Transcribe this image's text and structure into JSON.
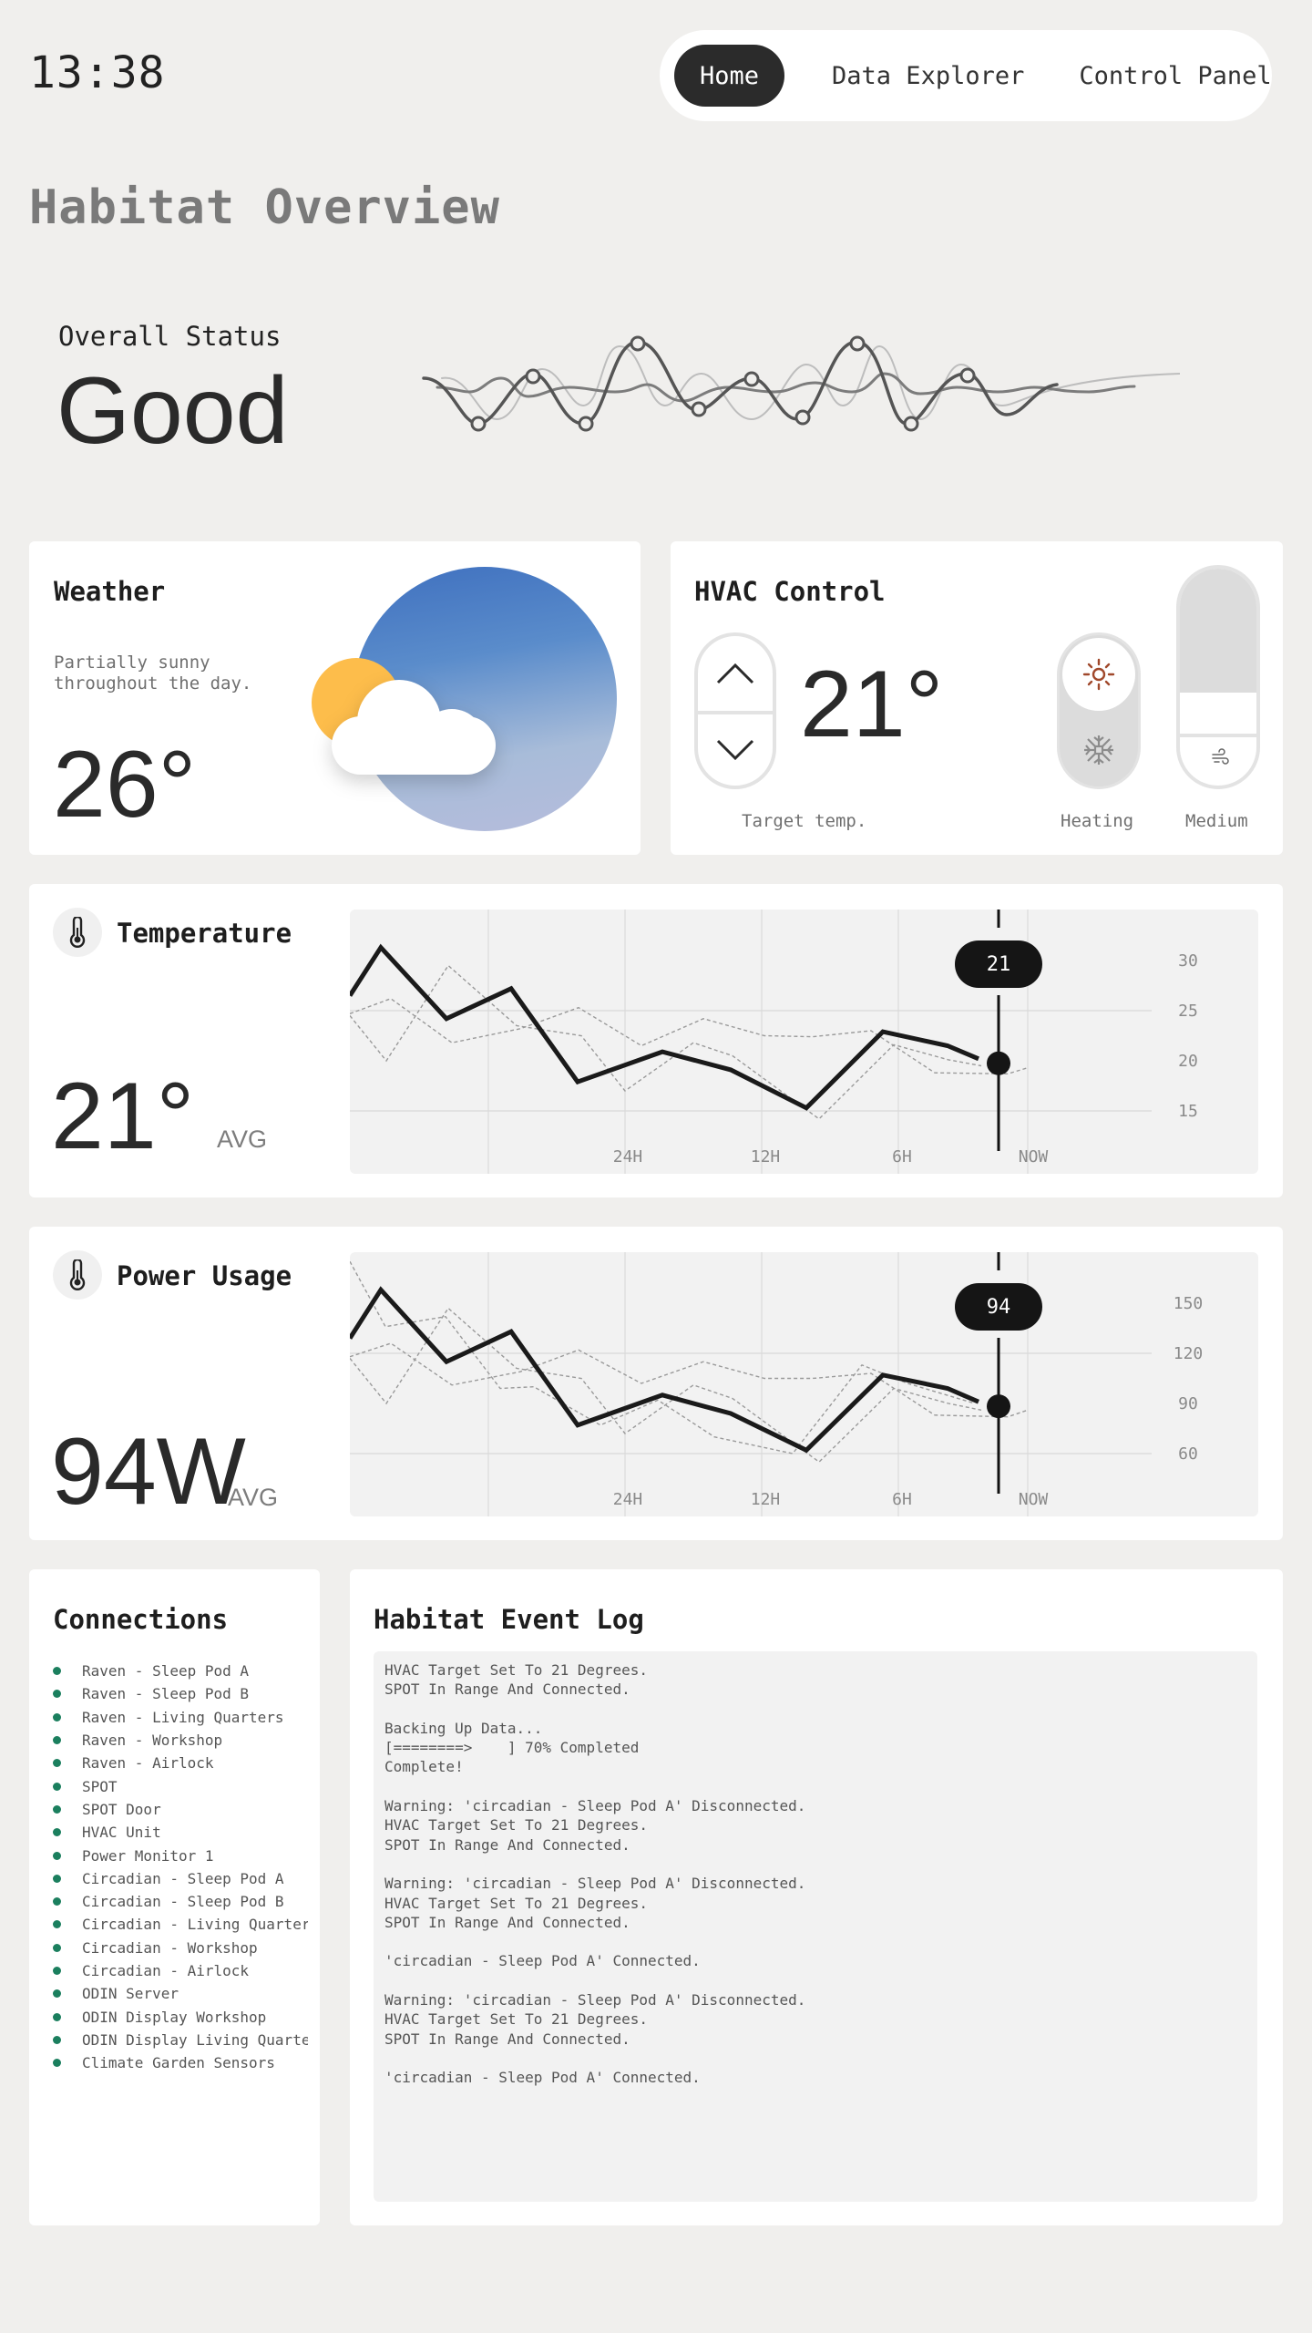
{
  "header": {
    "clock": "13:38",
    "nav": [
      {
        "label": "Home",
        "active": true
      },
      {
        "label": "Data Explorer",
        "active": false
      },
      {
        "label": "Control Panel",
        "active": false
      }
    ],
    "page_title": "Habitat Overview"
  },
  "status": {
    "label": "Overall Status",
    "value": "Good"
  },
  "weather": {
    "title": "Weather",
    "description": "Partially sunny throughout the day.",
    "temperature": "26°",
    "icon": "partly-cloudy-icon"
  },
  "hvac": {
    "title": "HVAC Control",
    "target_temp": "21°",
    "target_label": "Target temp.",
    "mode_label": "Heating",
    "fan_label": "Medium",
    "fan_level": 0.33,
    "mode": "heating",
    "colors": {
      "heat_icon": "#a0482b",
      "cool_icon": "#8c8c8c"
    }
  },
  "temperature": {
    "title": "Temperature",
    "value": "21°",
    "avg_label": "AVG",
    "icon": "thermometer-icon"
  },
  "power": {
    "title": "Power Usage",
    "value": "94W",
    "avg_label": "AVG",
    "icon": "thermometer-icon"
  },
  "chart_data": [
    {
      "type": "line",
      "title": "Temperature",
      "x_ticks": [
        "24H",
        "12H",
        "6H",
        "NOW"
      ],
      "y_ticks": [
        30,
        25,
        20,
        15
      ],
      "ylim": [
        10,
        35
      ],
      "grid": true,
      "cursor_value": "21",
      "series": [
        {
          "name": "average",
          "style": "solid",
          "values": [
            26.5,
            31.3,
            24.2,
            27.2,
            17.9,
            20.9,
            19.1,
            15.3,
            22.9,
            21.5,
            20.2
          ]
        },
        {
          "name": "sensor-a",
          "style": "dashed",
          "values": [
            24.5,
            20.0,
            29.5,
            23.5,
            22.5,
            17.0,
            21.8,
            20.5,
            14.2,
            21.6,
            20.1,
            19.5
          ]
        },
        {
          "name": "sensor-b",
          "style": "dashed",
          "values": [
            24.7,
            26.2,
            21.8,
            23.2,
            25.3,
            21.5,
            24.2,
            22.5,
            22.4,
            23.0,
            18.8,
            18.7,
            19.3
          ]
        }
      ]
    },
    {
      "type": "line",
      "title": "Power Usage",
      "x_ticks": [
        "24H",
        "12H",
        "6H",
        "NOW"
      ],
      "y_ticks": [
        150,
        120,
        90,
        60
      ],
      "ylim": [
        30,
        180
      ],
      "grid": true,
      "cursor_value": "94",
      "series": [
        {
          "name": "average",
          "style": "solid",
          "values": [
            129,
            158,
            115,
            133,
            77,
            95,
            84,
            62,
            107,
            99,
            91
          ]
        },
        {
          "name": "sensor-a",
          "style": "dashed",
          "values": [
            117,
            90,
            147,
            111,
            105,
            72,
            101,
            93,
            55,
            99,
            90,
            86
          ]
        },
        {
          "name": "sensor-b",
          "style": "dashed",
          "values": [
            118,
            126,
            101,
            109,
            122,
            102,
            115,
            105,
            105,
            108,
            83,
            82,
            86
          ]
        },
        {
          "name": "sensor-c",
          "style": "dashed",
          "values": [
            175,
            136,
            142,
            99,
            100,
            77,
            92,
            70,
            60,
            113,
            102,
            90
          ]
        }
      ]
    }
  ],
  "connections": {
    "title": "Connections",
    "status_color": "#1b7f5e",
    "items": [
      "Raven - Sleep Pod A",
      "Raven - Sleep Pod B",
      "Raven - Living Quarters",
      "Raven - Workshop",
      "Raven - Airlock",
      "SPOT",
      "SPOT Door",
      "HVAC Unit",
      "Power Monitor 1",
      "Circadian - Sleep Pod A",
      "Circadian - Sleep Pod B",
      "Circadian - Living Quarters",
      "Circadian - Workshop",
      "Circadian - Airlock",
      "ODIN Server",
      "ODIN Display Workshop",
      "ODIN Display Living Quarters",
      "Climate Garden Sensors"
    ]
  },
  "event_log": {
    "title": "Habitat Event Log",
    "lines": [
      "HVAC Target Set To 21 Degrees.",
      "SPOT In Range And Connected.",
      "",
      "Backing Up Data...",
      "[========>    ] 70% Completed",
      "Complete!",
      "",
      "Warning: 'circadian - Sleep Pod A' Disconnected.",
      "HVAC Target Set To 21 Degrees.",
      "SPOT In Range And Connected.",
      "",
      "Warning: 'circadian - Sleep Pod A' Disconnected.",
      "HVAC Target Set To 21 Degrees.",
      "SPOT In Range And Connected.",
      "",
      "'circadian - Sleep Pod A' Connected.",
      "",
      "Warning: 'circadian - Sleep Pod A' Disconnected.",
      "HVAC Target Set To 21 Degrees.",
      "SPOT In Range And Connected.",
      "",
      "'circadian - Sleep Pod A' Connected."
    ]
  }
}
